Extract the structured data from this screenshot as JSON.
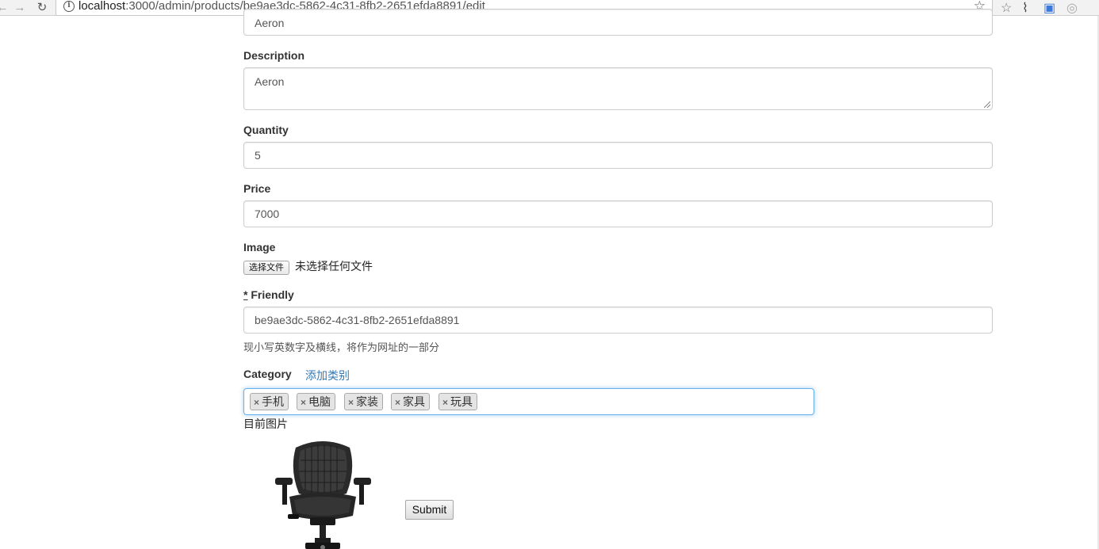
{
  "browser": {
    "url_host": "localhost",
    "url_rest": ":3000/admin/products/be9ae3dc-5862-4c31-8fb2-2651efda8891/edit"
  },
  "form": {
    "title_value": "Aeron",
    "description_label": "Description",
    "description_value": "Aeron",
    "quantity_label": "Quantity",
    "quantity_value": "5",
    "price_label": "Price",
    "price_value": "7000",
    "image_label": "Image",
    "file_button": "选择文件",
    "file_status": "未选择任何文件",
    "friendly_required": "*",
    "friendly_label": " Friendly",
    "friendly_value": "be9ae3dc-5862-4c31-8fb2-2651efda8891",
    "friendly_help": "现小写英数字及横线，将作为网址的一部分",
    "category_label": "Category",
    "add_category_link": "添加类别",
    "category_tags": [
      "手机",
      "电脑",
      "家装",
      "家具",
      "玩具"
    ],
    "tag_remove_symbol": "×",
    "current_image_label": "目前图片",
    "submit_label": "Submit"
  },
  "colors": {
    "link": "#337ab7",
    "focus_border": "#66afe9"
  }
}
